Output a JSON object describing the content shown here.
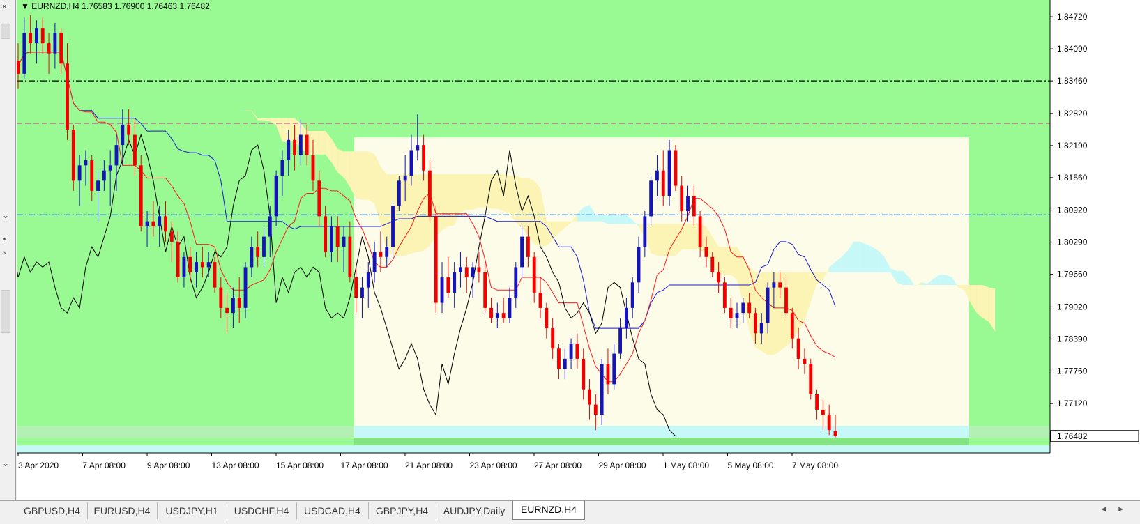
{
  "symbol_bar": {
    "symbol": "EURNZD,H4",
    "open": "1.76583",
    "high": "1.76900",
    "low": "1.76463",
    "close": "1.76482"
  },
  "chart_data": {
    "type": "candlestick",
    "symbol": "EURNZD",
    "timeframe": "H4",
    "price_axis": [
      "1.84720",
      "1.84090",
      "1.83460",
      "1.82820",
      "1.82190",
      "1.81560",
      "1.80920",
      "1.80290",
      "1.79660",
      "1.79020",
      "1.78390",
      "1.77760",
      "1.77120"
    ],
    "current_price": "1.76482",
    "time_axis": [
      "3 Apr 2020",
      "7 Apr 08:00",
      "9 Apr 08:00",
      "13 Apr 08:00",
      "15 Apr 08:00",
      "17 Apr 08:00",
      "21 Apr 08:00",
      "23 Apr 08:00",
      "27 Apr 08:00",
      "29 Apr 08:00",
      "1 May 08:00",
      "5 May 08:00",
      "7 May 08:00"
    ],
    "ylim": [
      1.7615,
      1.8505
    ],
    "horizontal_levels": [
      {
        "price": 1.8346,
        "style": "dash-dot",
        "color": "#000000"
      },
      {
        "price": 1.8263,
        "style": "dashed",
        "color": "#8b1a4a"
      },
      {
        "price": 1.8083,
        "style": "dash-dot",
        "color": "#1e6fd9"
      }
    ],
    "candles": [
      [
        1.8385,
        1.842,
        1.833,
        1.836
      ],
      [
        1.836,
        1.847,
        1.835,
        1.844
      ],
      [
        1.844,
        1.8475,
        1.84,
        1.842
      ],
      [
        1.842,
        1.8465,
        1.838,
        1.845
      ],
      [
        1.845,
        1.847,
        1.84,
        1.842
      ],
      [
        1.842,
        1.844,
        1.836,
        1.84
      ],
      [
        1.84,
        1.846,
        1.837,
        1.844
      ],
      [
        1.844,
        1.845,
        1.836,
        1.838
      ],
      [
        1.838,
        1.842,
        1.823,
        1.825
      ],
      [
        1.825,
        1.826,
        1.813,
        1.815
      ],
      [
        1.815,
        1.82,
        1.81,
        1.818
      ],
      [
        1.818,
        1.821,
        1.814,
        1.819
      ],
      [
        1.819,
        1.82,
        1.811,
        1.813
      ],
      [
        1.813,
        1.817,
        1.807,
        1.815
      ],
      [
        1.815,
        1.819,
        1.813,
        1.817
      ],
      [
        1.817,
        1.821,
        1.81,
        1.818
      ],
      [
        1.818,
        1.824,
        1.813,
        1.822
      ],
      [
        1.822,
        1.829,
        1.818,
        1.826
      ],
      [
        1.826,
        1.829,
        1.822,
        1.824
      ],
      [
        1.824,
        1.827,
        1.816,
        1.818
      ],
      [
        1.818,
        1.82,
        1.805,
        1.806
      ],
      [
        1.806,
        1.809,
        1.802,
        1.807
      ],
      [
        1.807,
        1.811,
        1.804,
        1.806
      ],
      [
        1.806,
        1.81,
        1.802,
        1.808
      ],
      [
        1.808,
        1.811,
        1.803,
        1.805
      ],
      [
        1.805,
        1.807,
        1.799,
        1.803
      ],
      [
        1.803,
        1.805,
        1.795,
        1.796
      ],
      [
        1.796,
        1.801,
        1.794,
        1.8
      ],
      [
        1.8,
        1.802,
        1.795,
        1.797
      ],
      [
        1.797,
        1.801,
        1.794,
        1.799
      ],
      [
        1.799,
        1.802,
        1.796,
        1.798
      ],
      [
        1.798,
        1.801,
        1.796,
        1.799
      ],
      [
        1.799,
        1.8,
        1.793,
        1.794
      ],
      [
        1.794,
        1.796,
        1.788,
        1.79
      ],
      [
        1.79,
        1.793,
        1.785,
        1.789
      ],
      [
        1.789,
        1.794,
        1.786,
        1.792
      ],
      [
        1.792,
        1.796,
        1.787,
        1.79
      ],
      [
        1.79,
        1.799,
        1.788,
        1.798
      ],
      [
        1.798,
        1.804,
        1.796,
        1.802
      ],
      [
        1.802,
        1.805,
        1.798,
        1.8
      ],
      [
        1.8,
        1.806,
        1.798,
        1.804
      ],
      [
        1.804,
        1.81,
        1.8,
        1.808
      ],
      [
        1.808,
        1.817,
        1.806,
        1.816
      ],
      [
        1.816,
        1.821,
        1.812,
        1.819
      ],
      [
        1.819,
        1.825,
        1.816,
        1.823
      ],
      [
        1.823,
        1.826,
        1.817,
        1.82
      ],
      [
        1.82,
        1.827,
        1.818,
        1.824
      ],
      [
        1.824,
        1.826,
        1.818,
        1.82
      ],
      [
        1.82,
        1.823,
        1.813,
        1.815
      ],
      [
        1.815,
        1.817,
        1.806,
        1.808
      ],
      [
        1.808,
        1.81,
        1.8,
        1.801
      ],
      [
        1.801,
        1.808,
        1.799,
        1.806
      ],
      [
        1.806,
        1.808,
        1.799,
        1.802
      ],
      [
        1.802,
        1.806,
        1.797,
        1.804
      ],
      [
        1.804,
        1.807,
        1.795,
        1.796
      ],
      [
        1.796,
        1.798,
        1.789,
        1.792
      ],
      [
        1.792,
        1.796,
        1.788,
        1.794
      ],
      [
        1.794,
        1.799,
        1.79,
        1.797
      ],
      [
        1.797,
        1.803,
        1.795,
        1.801
      ],
      [
        1.801,
        1.805,
        1.797,
        1.8
      ],
      [
        1.8,
        1.804,
        1.798,
        1.802
      ],
      [
        1.802,
        1.811,
        1.8,
        1.81
      ],
      [
        1.81,
        1.816,
        1.809,
        1.815
      ],
      [
        1.815,
        1.82,
        1.811,
        1.816
      ],
      [
        1.816,
        1.824,
        1.814,
        1.821
      ],
      [
        1.821,
        1.828,
        1.819,
        1.822
      ],
      [
        1.822,
        1.824,
        1.815,
        1.817
      ],
      [
        1.817,
        1.819,
        1.807,
        1.808
      ],
      [
        1.808,
        1.81,
        1.789,
        1.791
      ],
      [
        1.791,
        1.799,
        1.789,
        1.796
      ],
      [
        1.796,
        1.8,
        1.792,
        1.793
      ],
      [
        1.793,
        1.799,
        1.79,
        1.797
      ],
      [
        1.797,
        1.801,
        1.794,
        1.798
      ],
      [
        1.798,
        1.8,
        1.793,
        1.796
      ],
      [
        1.796,
        1.799,
        1.792,
        1.798
      ],
      [
        1.798,
        1.801,
        1.795,
        1.797
      ],
      [
        1.797,
        1.799,
        1.789,
        1.79
      ],
      [
        1.79,
        1.792,
        1.787,
        1.788
      ],
      [
        1.788,
        1.791,
        1.786,
        1.789
      ],
      [
        1.789,
        1.792,
        1.787,
        1.788
      ],
      [
        1.788,
        1.794,
        1.787,
        1.792
      ],
      [
        1.792,
        1.799,
        1.79,
        1.798
      ],
      [
        1.798,
        1.806,
        1.796,
        1.804
      ],
      [
        1.804,
        1.806,
        1.798,
        1.8
      ],
      [
        1.8,
        1.801,
        1.791,
        1.793
      ],
      [
        1.793,
        1.796,
        1.788,
        1.79
      ],
      [
        1.79,
        1.791,
        1.784,
        1.786
      ],
      [
        1.786,
        1.788,
        1.78,
        1.782
      ],
      [
        1.782,
        1.783,
        1.776,
        1.778
      ],
      [
        1.778,
        1.782,
        1.776,
        1.78
      ],
      [
        1.78,
        1.784,
        1.778,
        1.783
      ],
      [
        1.783,
        1.785,
        1.778,
        1.78
      ],
      [
        1.78,
        1.782,
        1.772,
        1.774
      ],
      [
        1.774,
        1.776,
        1.768,
        1.771
      ],
      [
        1.771,
        1.773,
        1.766,
        1.769
      ],
      [
        1.769,
        1.78,
        1.767,
        1.779
      ],
      [
        1.779,
        1.782,
        1.773,
        1.775
      ],
      [
        1.775,
        1.783,
        1.774,
        1.781
      ],
      [
        1.781,
        1.788,
        1.78,
        1.786
      ],
      [
        1.786,
        1.792,
        1.784,
        1.79
      ],
      [
        1.79,
        1.796,
        1.788,
        1.795
      ],
      [
        1.795,
        1.804,
        1.793,
        1.802
      ],
      [
        1.802,
        1.809,
        1.8,
        1.808
      ],
      [
        1.808,
        1.816,
        1.806,
        1.815
      ],
      [
        1.815,
        1.82,
        1.812,
        1.817
      ],
      [
        1.817,
        1.821,
        1.81,
        1.812
      ],
      [
        1.812,
        1.823,
        1.81,
        1.821
      ],
      [
        1.821,
        1.822,
        1.813,
        1.814
      ],
      [
        1.814,
        1.816,
        1.807,
        1.809
      ],
      [
        1.809,
        1.814,
        1.807,
        1.812
      ],
      [
        1.812,
        1.814,
        1.806,
        1.808
      ],
      [
        1.808,
        1.809,
        1.8,
        1.802
      ],
      [
        1.802,
        1.804,
        1.798,
        1.8
      ],
      [
        1.8,
        1.801,
        1.796,
        1.797
      ],
      [
        1.797,
        1.799,
        1.793,
        1.795
      ],
      [
        1.795,
        1.796,
        1.789,
        1.79
      ],
      [
        1.79,
        1.792,
        1.786,
        1.788
      ],
      [
        1.788,
        1.791,
        1.786,
        1.789
      ],
      [
        1.789,
        1.792,
        1.787,
        1.791
      ],
      [
        1.791,
        1.793,
        1.788,
        1.789
      ],
      [
        1.789,
        1.79,
        1.783,
        1.785
      ],
      [
        1.785,
        1.789,
        1.783,
        1.787
      ],
      [
        1.787,
        1.795,
        1.785,
        1.794
      ],
      [
        1.794,
        1.797,
        1.79,
        1.795
      ],
      [
        1.795,
        1.797,
        1.792,
        1.794
      ],
      [
        1.794,
        1.796,
        1.788,
        1.789
      ],
      [
        1.789,
        1.79,
        1.782,
        1.784
      ],
      [
        1.784,
        1.786,
        1.778,
        1.78
      ],
      [
        1.78,
        1.782,
        1.777,
        1.779
      ],
      [
        1.779,
        1.78,
        1.772,
        1.773
      ],
      [
        1.773,
        1.774,
        1.768,
        1.77
      ],
      [
        1.77,
        1.772,
        1.766,
        1.769
      ],
      [
        1.769,
        1.771,
        1.765,
        1.766
      ],
      [
        1.7658,
        1.769,
        1.7646,
        1.7648
      ]
    ]
  },
  "tabs": [
    {
      "label": "GBPUSD,H4",
      "active": false
    },
    {
      "label": "EURUSD,H4",
      "active": false
    },
    {
      "label": "USDJPY,H1",
      "active": false
    },
    {
      "label": "USDCHF,H4",
      "active": false
    },
    {
      "label": "USDCAD,H4",
      "active": false
    },
    {
      "label": "GBPJPY,H4",
      "active": false
    },
    {
      "label": "AUDJPY,Daily",
      "active": false
    },
    {
      "label": "EURNZD,H4",
      "active": true
    }
  ],
  "colors": {
    "background": "#99fa94",
    "bull": "#1414b8",
    "bear": "#f20000",
    "tenkan": "#ff1a1a",
    "kijun": "#1a1acc",
    "chikou": "#000000",
    "kumo_bull": "#c6f8f8",
    "kumo_bear": "#fbf4b4",
    "rectangle": "#fcfce8"
  }
}
